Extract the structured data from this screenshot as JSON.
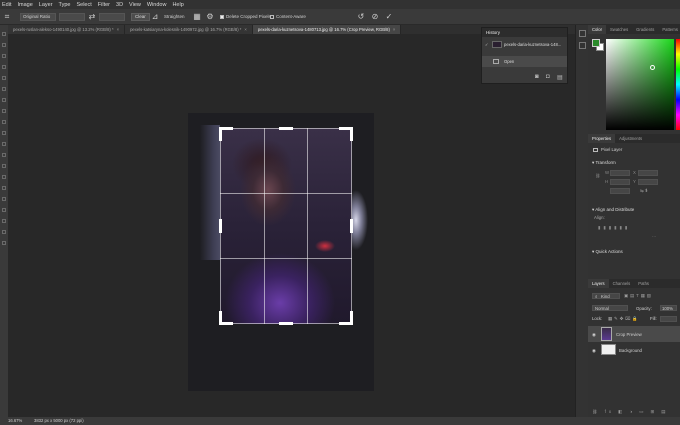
{
  "menu": [
    "Edit",
    "Image",
    "Layer",
    "Type",
    "Select",
    "Filter",
    "3D",
    "View",
    "Window",
    "Help"
  ],
  "options": {
    "ratio": "Original Ratio",
    "clear": "Clear",
    "straighten": "Straighten",
    "delete_cropped": "Delete Cropped Pixels",
    "content_aware": "Content-Aware"
  },
  "tabs": [
    {
      "label": "pexels-ruslan-alekso-1490140.jpg @ 13.2% (RGB/8) *",
      "active": false
    },
    {
      "label": "pexels-katsiaryna-kolesnik-1490972.jpg @ 16.7% (RGB/8) *",
      "active": false
    },
    {
      "label": "pexels-daria-kuznetsova-1480713.jpg @ 16.7% (Crop Preview, RGB/8)",
      "active": true
    }
  ],
  "history": {
    "title": "History",
    "snapshot": "pexels-daria-kuznetsova-148...",
    "item": "Open"
  },
  "color": {
    "tabs": [
      "Color",
      "Swatches",
      "Gradients",
      "Patterns"
    ],
    "fg": "#2b8a2b",
    "bg": "#ffffff"
  },
  "properties": {
    "tabs": [
      "Properties",
      "Adjustments"
    ],
    "layer_type": "Pixel Layer",
    "transform": "Transform",
    "w": "W",
    "h": "H",
    "x": "X",
    "y": "Y",
    "align": "Align and Distribute",
    "align_to": "Align:",
    "quick": "Quick Actions"
  },
  "layers": {
    "tabs": [
      "Layers",
      "Channels",
      "Paths"
    ],
    "kind": "Kind",
    "blend": "Normal",
    "opacity_label": "Opacity:",
    "opacity": "100%",
    "lock_label": "Lock:",
    "fill_label": "Fill:",
    "items": [
      {
        "name": "Crop Preview",
        "selected": true
      },
      {
        "name": "Background",
        "selected": false
      }
    ]
  },
  "status": {
    "zoom": "16.67%",
    "doc": "3832 px x 5000 px (72 ppi)"
  }
}
